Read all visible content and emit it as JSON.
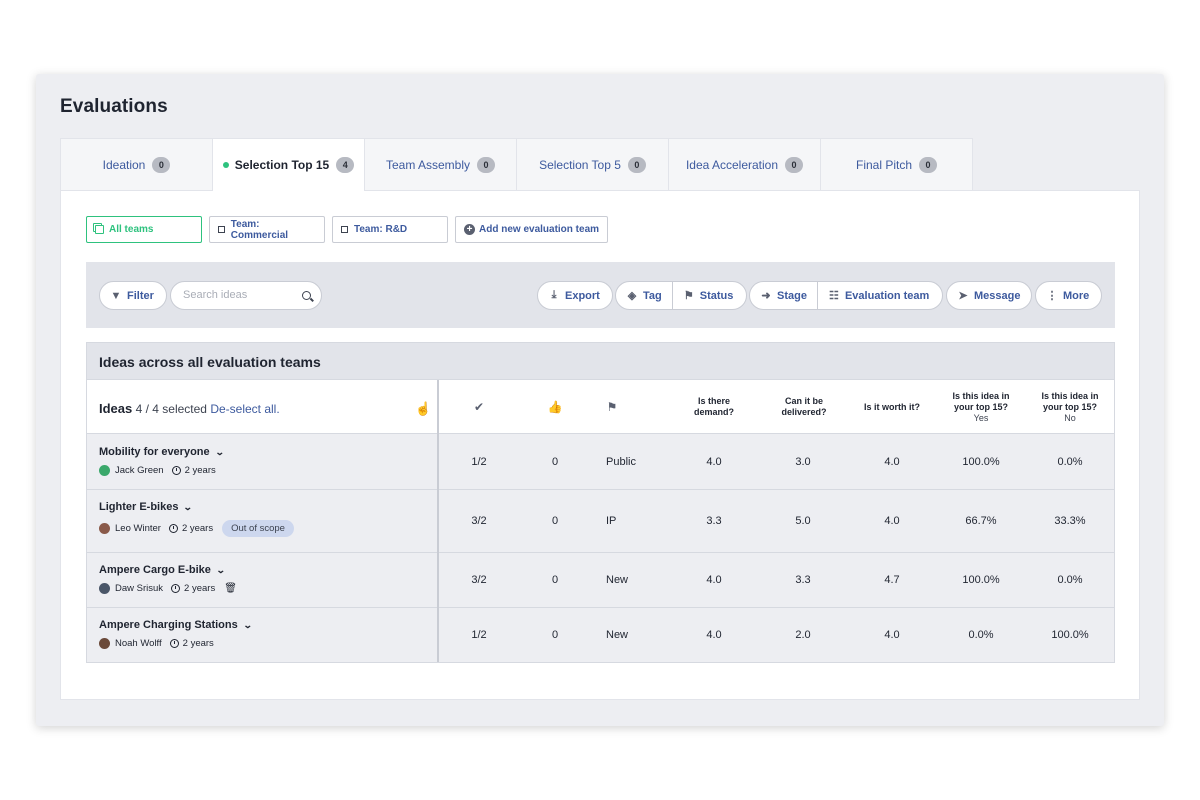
{
  "page": {
    "title": "Evaluations"
  },
  "tabs": [
    {
      "label": "Ideation",
      "count": "0",
      "active": false
    },
    {
      "label": "Selection Top 15",
      "count": "4",
      "active": true
    },
    {
      "label": "Team Assembly",
      "count": "0",
      "active": false
    },
    {
      "label": "Selection Top 5",
      "count": "0",
      "active": false
    },
    {
      "label": "Idea Acceleration",
      "count": "0",
      "active": false
    },
    {
      "label": "Final Pitch",
      "count": "0",
      "active": false
    }
  ],
  "teams": {
    "all": "All teams",
    "commercial": "Team: Commercial",
    "rnd": "Team: R&D",
    "add": "Add new evaluation team"
  },
  "toolbar": {
    "filter": "Filter",
    "search_placeholder": "Search ideas",
    "export": "Export",
    "tag": "Tag",
    "status": "Status",
    "stage": "Stage",
    "evaluation_team": "Evaluation team",
    "message": "Message",
    "more": "More"
  },
  "table": {
    "title": "Ideas across all evaluation teams",
    "ideas_label": "Ideas",
    "selected_text": "4 / 4 selected",
    "deselect_link": "De-select all.",
    "columns": {
      "demand": "Is there demand?",
      "delivered": "Can it be delivered?",
      "worth": "Is it worth it?",
      "top15_yes_title": "Is this idea in your top 15?",
      "top15_yes_sub": "Yes",
      "top15_no_title": "Is this idea in your top 15?",
      "top15_no_sub": "No"
    },
    "rows": [
      {
        "title": "Mobility for everyone",
        "author": "Jack Green",
        "age": "2 years",
        "badge": "",
        "votes": "1/2",
        "likes": "0",
        "status": "Public",
        "demand": "4.0",
        "delivered": "3.0",
        "worth": "4.0",
        "yes": "100.0%",
        "no": "0.0%",
        "avatar_color": "#3aa86b"
      },
      {
        "title": "Lighter E-bikes",
        "author": "Leo Winter",
        "age": "2 years",
        "badge": "Out of scope",
        "votes": "3/2",
        "likes": "0",
        "status": "IP",
        "demand": "3.3",
        "delivered": "5.0",
        "worth": "4.0",
        "yes": "66.7%",
        "no": "33.3%",
        "avatar_color": "#8a5a4a"
      },
      {
        "title": "Ampere Cargo E-bike",
        "author": "Daw Srisuk",
        "age": "2 years",
        "badge": "",
        "votes": "3/2",
        "likes": "0",
        "status": "New",
        "demand": "4.0",
        "delivered": "3.3",
        "worth": "4.7",
        "yes": "100.0%",
        "no": "0.0%",
        "avatar_color": "#4a5668"
      },
      {
        "title": "Ampere Charging Stations",
        "author": "Noah Wolff",
        "age": "2 years",
        "badge": "",
        "votes": "1/2",
        "likes": "0",
        "status": "New",
        "demand": "4.0",
        "delivered": "2.0",
        "worth": "4.0",
        "yes": "0.0%",
        "no": "100.0%",
        "avatar_color": "#6b4a3a"
      }
    ]
  },
  "colors": {
    "accent": "#3d5a9e",
    "active_team": "#2ec27e",
    "badge_bg": "#cdd7ee"
  }
}
